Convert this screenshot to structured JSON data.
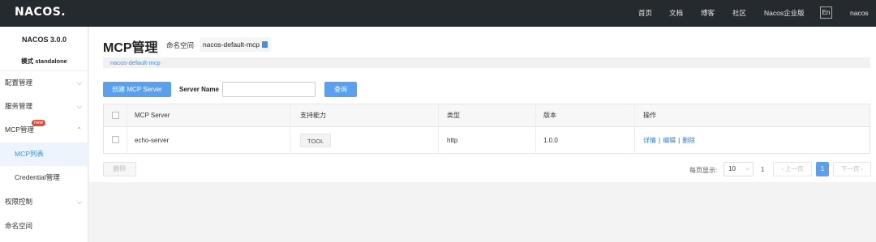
{
  "topbar": {
    "logo": "NACOS.",
    "nav": [
      "首页",
      "文档",
      "博客",
      "社区",
      "Nacos企业版"
    ],
    "lang": "En",
    "user": "nacos"
  },
  "sidebar": {
    "version": "NACOS 3.0.0",
    "mode": "模式 standalone",
    "items": [
      {
        "label": "配置管理"
      },
      {
        "label": "服务管理"
      },
      {
        "label": "MCP管理",
        "badge": "new"
      },
      {
        "label": "MCP列表"
      },
      {
        "label": "Credential管理"
      },
      {
        "label": "权限控制"
      },
      {
        "label": "命名空间"
      }
    ]
  },
  "main": {
    "title": "MCP管理",
    "namespace_label": "命名空间",
    "namespace_value": "nacos-default-mcp",
    "namespace_bar": "nacos-default-mcp",
    "create_button": "创建 MCP Server",
    "server_name_label": "Server Name",
    "server_name_value": "",
    "query_button": "查询",
    "table": {
      "headers": [
        "MCP Server",
        "支持能力",
        "类型",
        "版本",
        "操作"
      ],
      "rows": [
        {
          "name": "echo-server",
          "capability": "TOOL",
          "type": "http",
          "version": "1.0.0",
          "actions": [
            "详情",
            "编辑",
            "删除"
          ]
        }
      ]
    },
    "delete_button": "删除",
    "pagination": {
      "page_size_label": "每页显示:",
      "page_size": "10",
      "total": "1",
      "prev": "上一页",
      "current": "1",
      "next": "下一页"
    }
  },
  "colors": {
    "topbar": "#252a2f",
    "primary": "#5aa0ee",
    "link": "#2f7fd6",
    "badge": "#e04a3a"
  }
}
